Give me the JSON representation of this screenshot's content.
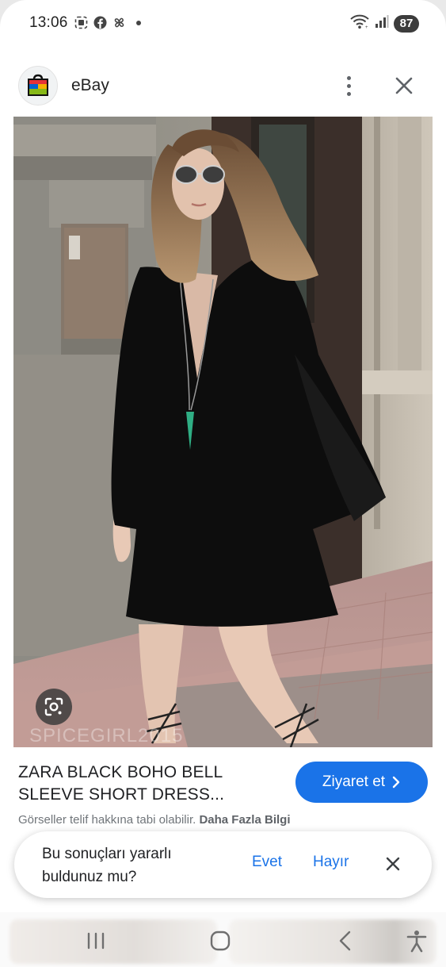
{
  "status_bar": {
    "time": "13:06",
    "battery": "87",
    "icons": [
      "screenshot-icon",
      "facebook-icon",
      "pinwheel-icon",
      "notification-dot"
    ],
    "right_icons": [
      "wifi-icon",
      "signal-icon",
      "battery-icon"
    ]
  },
  "header": {
    "site_name": "eBay",
    "logo_icon": "ebay-shopping-bag-logo",
    "menu_icon": "more-vertical-icon",
    "close_icon": "close-icon"
  },
  "image": {
    "watermark": "SPICEGIRL2015",
    "lens_icon": "lens-search-icon"
  },
  "result": {
    "title": "ZARA BLACK BOHO BELL SLEEVE SHORT DRESS...",
    "visit_label": "Ziyaret et",
    "visit_icon": "chevron-right-icon",
    "copyright_text": "Görseller telif hakkına tabi olabilir.",
    "learn_more": "Daha Fazla Bilgi"
  },
  "feedback": {
    "question": "Bu sonuçları yararlı buldunuz mu?",
    "yes": "Evet",
    "no": "Hayır",
    "close_icon": "close-icon"
  },
  "nav": {
    "items": [
      "recent-apps-icon",
      "home-icon",
      "back-icon",
      "accessibility-icon"
    ]
  },
  "colors": {
    "accent": "#1a73e8",
    "text_primary": "#202124",
    "text_secondary": "#70757a",
    "dress": "#0d0d0d"
  }
}
